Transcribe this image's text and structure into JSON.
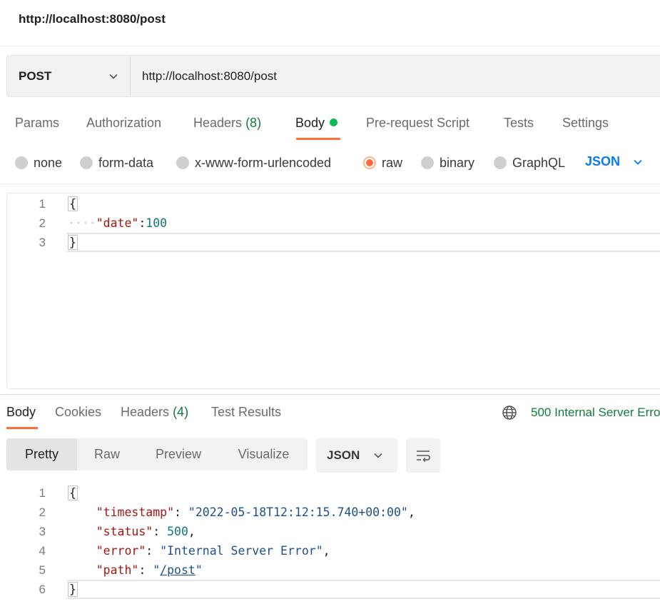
{
  "title": "http://localhost:8080/post",
  "request": {
    "method": "POST",
    "url": "http://localhost:8080/post"
  },
  "request_tabs": [
    {
      "label": "Params",
      "count": ""
    },
    {
      "label": "Authorization",
      "count": ""
    },
    {
      "label": "Headers",
      "count": "(8)"
    },
    {
      "label": "Body",
      "count": ""
    },
    {
      "label": "Pre-request Script",
      "count": ""
    },
    {
      "label": "Tests",
      "count": ""
    },
    {
      "label": "Settings",
      "count": ""
    }
  ],
  "active_request_tab": "Body",
  "body_options": [
    "none",
    "form-data",
    "x-www-form-urlencoded",
    "raw",
    "binary",
    "GraphQL"
  ],
  "selected_body_option": "raw",
  "body_language": "JSON",
  "request_body": {
    "line_numbers": [
      "1",
      "2",
      "3"
    ],
    "open_brace": "{",
    "indent_dots": "····",
    "key": "\"date\"",
    "colon": ":",
    "value": "100",
    "close_brace": "}"
  },
  "response_tabs": [
    {
      "label": "Body",
      "count": ""
    },
    {
      "label": "Cookies",
      "count": ""
    },
    {
      "label": "Headers",
      "count": "(4)"
    },
    {
      "label": "Test Results",
      "count": ""
    }
  ],
  "active_response_tab": "Body",
  "status_text": "500 Internal Server Erro",
  "view_tabs": [
    "Pretty",
    "Raw",
    "Preview",
    "Visualize"
  ],
  "active_view_tab": "Pretty",
  "response_format": "JSON",
  "response_body": {
    "line_numbers": [
      "1",
      "2",
      "3",
      "4",
      "5",
      "6"
    ],
    "open_brace": "{",
    "close_brace": "}",
    "fields": [
      {
        "key": "\"timestamp\"",
        "value": "\"2022-05-18T12:12:15.740+00:00\"",
        "type": "string",
        "trail": ","
      },
      {
        "key": "\"status\"",
        "value": "500",
        "type": "number",
        "trail": ","
      },
      {
        "key": "\"error\"",
        "value": "\"Internal Server Error\"",
        "type": "string",
        "trail": ","
      },
      {
        "key": "\"path\"",
        "value_prefix": "\"",
        "value_link": "/post",
        "value_suffix": "\"",
        "type": "link",
        "trail": ""
      }
    ]
  },
  "colors": {
    "accent": "#ff6c37",
    "status_green": "#0f7b3e",
    "link_blue": "#097bed"
  }
}
